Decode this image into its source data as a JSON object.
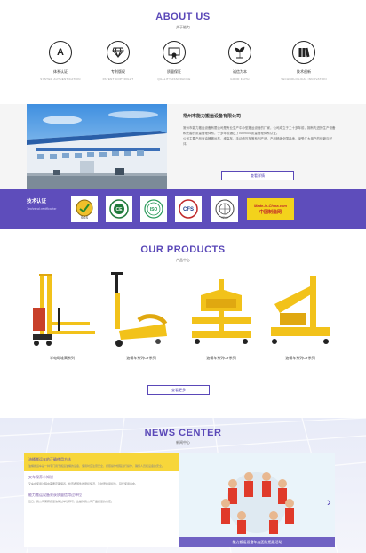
{
  "about": {
    "title": "ABOUT US",
    "subtitle": "关于能力",
    "features": [
      {
        "name": "体系认证",
        "en": "SYSTEM AUTHENTICATION",
        "icon": "letter-a-icon"
      },
      {
        "name": "专利版权",
        "en": "PATENT COPYRIGHT",
        "icon": "diamond-icon"
      },
      {
        "name": "质量保证",
        "en": "QUALITY ASSURANCE",
        "icon": "certificate-icon"
      },
      {
        "name": "诚信为本",
        "en": "GOOD FAITH",
        "icon": "plant-icon"
      },
      {
        "name": "技术创新",
        "en": "TECHNOLOGICAL INNOVATION",
        "icon": "books-icon"
      }
    ]
  },
  "company": {
    "name": "常州市能力搬运设备有限公司",
    "desc1": "常州市能力搬运设备有限公司是专业生产中小型搬运设备的厂家，公司成立于二十多年前，拥有先进的生产设备和完善的质量管理体系，于多年前通过了ISO9001质量管理体系认证。",
    "desc2": "公司主要产品有油桶搬运车、堆高车、手动液压车等系列产品，产品畅销全国各地，深受广大用户的信赖与好评。",
    "more": "查看详情"
  },
  "cert": {
    "title": "技术认证",
    "subtitle": "Technical certification",
    "logos": [
      "SGS",
      "CE",
      "ISO",
      "CFS",
      "IQNet"
    ],
    "madeinchina_en": "Made-in-China.com",
    "madeinchina_cn": "中国制造网"
  },
  "products": {
    "title": "OUR PRODUCTS",
    "subtitle": "产品中心",
    "items": [
      {
        "name": "半电动堆高系列"
      },
      {
        "name": "油桶车系列CY系列"
      },
      {
        "name": "油桶车系列CY系列"
      },
      {
        "name": "油桶车系列CY系列"
      }
    ],
    "more": "查看更多"
  },
  "news": {
    "title": "NEWS CENTER",
    "subtitle": "新闻中心",
    "items": [
      {
        "title": "油桶搬运车的正确使用方法",
        "desc": "油桶搬运车是一种专门用于搬运油桶的设备，使用时应注意安全，按照操作规程进行操作，确保人员和设备的安全。"
      },
      {
        "title": "叉车保养小知识",
        "desc": "叉车在使用过程中需要定期保养，检查各部件的磨损情况，及时更换易损件，延长使用寿命。"
      },
      {
        "title": "能力搬运设备荣获质量信得过单位",
        "desc": "近日，我公司荣获质量信得过单位称号，这是对我公司产品质量的肯定。"
      }
    ],
    "photo_caption": "能力搬运设备年度团队拓展活动"
  }
}
